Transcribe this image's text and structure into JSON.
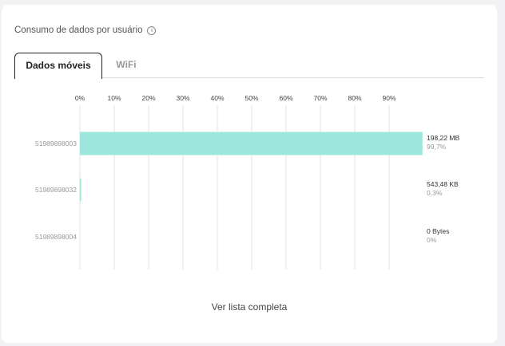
{
  "header": {
    "title": "Consumo de dados por usuário",
    "info_icon": "info-icon"
  },
  "tabs": [
    {
      "label": "Dados móveis",
      "active": true
    },
    {
      "label": "WiFi",
      "active": false
    }
  ],
  "chart_data": {
    "type": "bar",
    "orientation": "horizontal",
    "x_ticks": [
      "0%",
      "10%",
      "20%",
      "30%",
      "40%",
      "50%",
      "60%",
      "70%",
      "80%",
      "90%"
    ],
    "xlim": [
      0,
      100
    ],
    "grid": true,
    "bar_color": "#9de6dc",
    "categories": [
      "51989898003",
      "51989898032",
      "51989898004"
    ],
    "values": [
      99.7,
      0.3,
      0
    ],
    "value_labels": [
      "198,22 MB",
      "543,48 KB",
      "0 Bytes"
    ],
    "percent_labels": [
      "99,7%",
      "0,3%",
      "0%"
    ]
  },
  "footer": {
    "link_label": "Ver lista completa"
  }
}
